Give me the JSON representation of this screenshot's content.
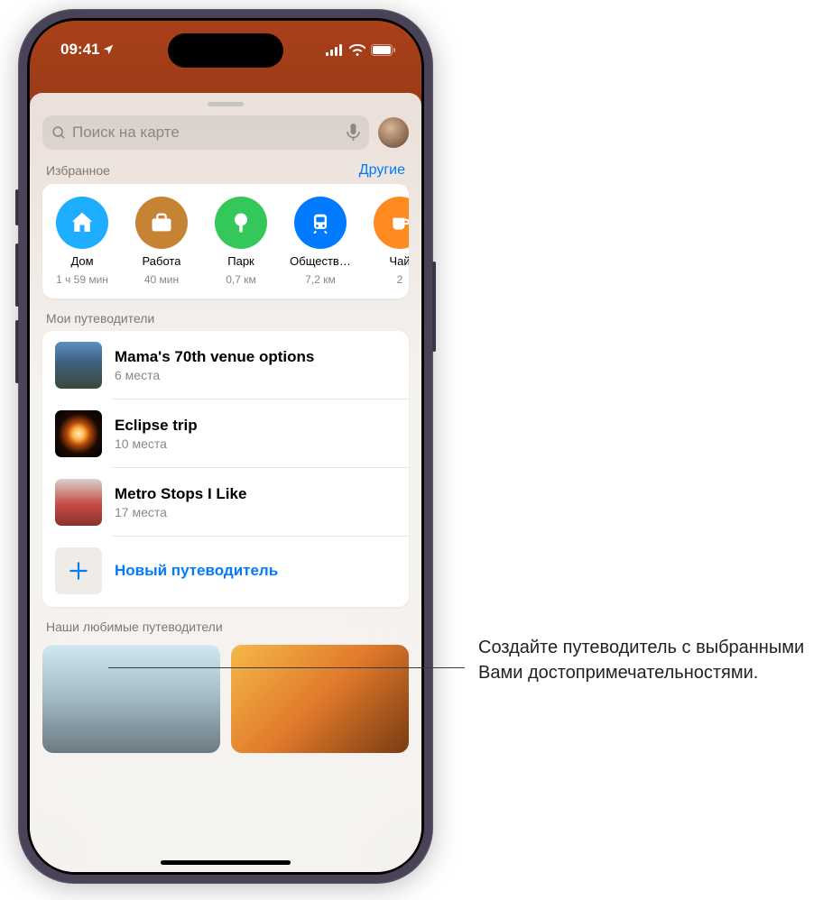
{
  "status": {
    "time": "09:41"
  },
  "search": {
    "placeholder": "Поиск на карте"
  },
  "favorites": {
    "title": "Избранное",
    "action": "Другие",
    "items": [
      {
        "label": "Дом",
        "sub": "1 ч 59 мин",
        "color": "#1eadff",
        "icon": "home"
      },
      {
        "label": "Работа",
        "sub": "40 мин",
        "color": "#c78334",
        "icon": "briefcase"
      },
      {
        "label": "Парк",
        "sub": "0,7 км",
        "color": "#34c759",
        "icon": "tree"
      },
      {
        "label": "Обществ…",
        "sub": "7,2 км",
        "color": "#007aff",
        "icon": "tram"
      },
      {
        "label": "Чай",
        "sub": "2",
        "color": "#ff8a1f",
        "icon": "cup"
      }
    ]
  },
  "my_guides": {
    "title": "Мои путеводители",
    "items": [
      {
        "title": "Mama's 70th venue options",
        "sub": "6 места"
      },
      {
        "title": "Eclipse trip",
        "sub": "10 места"
      },
      {
        "title": "Metro Stops I Like",
        "sub": "17 места"
      }
    ],
    "new_label": "Новый путеводитель"
  },
  "loved_guides": {
    "title": "Наши любимые путеводители"
  },
  "callout": "Создайте путеводитель с выбранными Вами достопримечательностями."
}
